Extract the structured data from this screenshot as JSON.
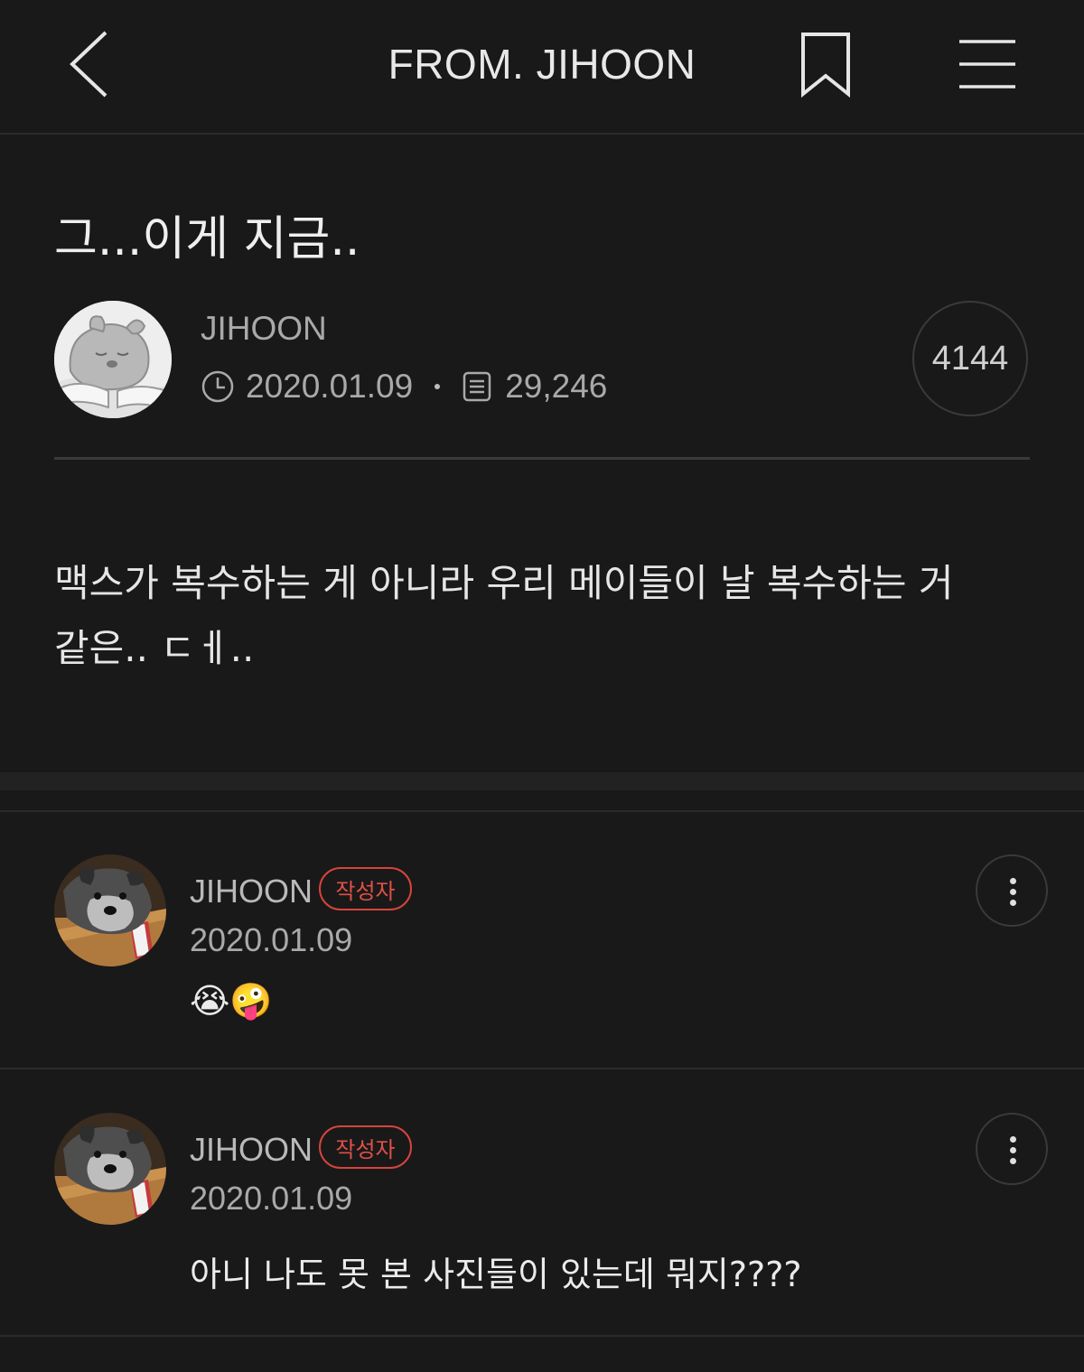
{
  "header": {
    "title": "FROM. JIHOON",
    "icons": {
      "back": "chevron-left-icon",
      "bookmark": "bookmark-icon",
      "menu": "hamburger-menu-icon"
    }
  },
  "post": {
    "title": "그...이게 지금..",
    "author": "JIHOON",
    "date": "2020.01.09",
    "views": "29,246",
    "count": "4144",
    "body": "맥스가 복수하는 게 아니라 우리 메이들이 날 복수하는 거\n같은.. ㄷㅔ.."
  },
  "comments": [
    {
      "author": "JIHOON",
      "badge": "작성자",
      "date": "2020.01.09",
      "text": "😭🤪"
    },
    {
      "author": "JIHOON",
      "badge": "작성자",
      "date": "2020.01.09",
      "text": "아니 나도 못 본 사진들이 있는데 뭐지????"
    }
  ],
  "colors": {
    "background": "#191919",
    "badge": "#d6443c",
    "text": "#e6e6e6",
    "muted": "#a9a9a9"
  }
}
